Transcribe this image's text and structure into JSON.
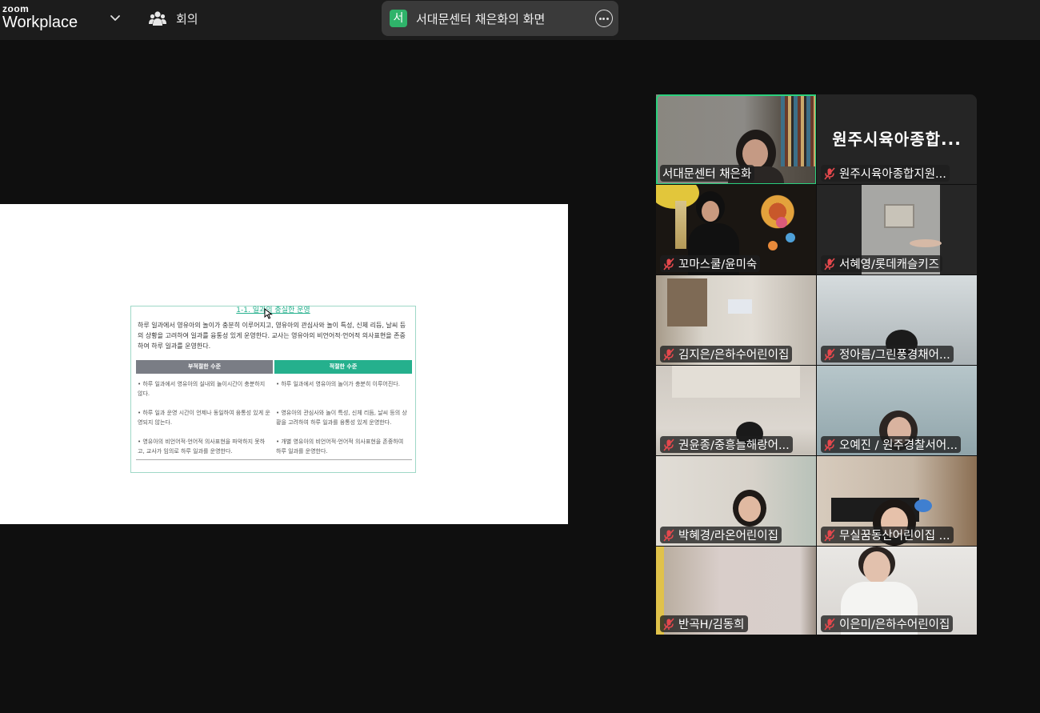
{
  "app": {
    "logo_small": "zoom",
    "logo_large": "Workplace"
  },
  "header": {
    "meeting_label": "회의",
    "share": {
      "badge": "서",
      "title": "서대문센터 채은화의 화면"
    }
  },
  "slide": {
    "title": "1-1. 일과의 충실한 운영",
    "paragraph": "하루 일과에서 영유아의 놀이가 충분히 이루어지고, 영유아의 관심사와 놀이 특성, 신체 리듬, 날씨 등의 상황을 고려하여 일과를 융통성 있게 운영한다. 교사는 영유아의 비언어적·언어적 의사표현을 존중하여 하루 일과를 운영한다.",
    "col_bad": "부적절한 수준",
    "col_good": "적절한 수준",
    "rows": [
      {
        "bad": "• 하루 일과에서 영유아의 실내외 놀이시간이 충분하지 않다.",
        "good": "• 하루 일과에서 영유아의 놀이가 충분히 이루어진다."
      },
      {
        "bad": "• 하루 일과 운영 시간이 언제나 동일하여 융통성 있게 운영되지 않는다.",
        "good": "• 영유아의 관심사와 놀이 특성, 신체 리듬, 날씨 등의 상황을 고려하여 하루 일과를 융통성 있게 운영한다."
      },
      {
        "bad": "• 영유아의 비언어적·언어적 의사표현을 파악하지 못하고, 교사가 임의로 하루 일과를 운영한다.",
        "good": "• 개별 영유아의 비언어적·언어적 의사표현을 존중하여 하루 일과를 운영한다."
      }
    ]
  },
  "participants": [
    {
      "name": "서대문센터 채은화",
      "muted": false,
      "active": true
    },
    {
      "name": "원주시육아종합지원...",
      "muted": true,
      "avatar_text": "원주시육아종합..."
    },
    {
      "name": "꼬마스쿨/윤미숙",
      "muted": true
    },
    {
      "name": "서혜영/롯데캐슬키즈",
      "muted": true
    },
    {
      "name": "김지은/은하수어린이집",
      "muted": true
    },
    {
      "name": "정아름/그린풍경채어...",
      "muted": true
    },
    {
      "name": "권윤종/중흥늘해랑어...",
      "muted": true
    },
    {
      "name": "오예진 / 원주경찰서어...",
      "muted": true
    },
    {
      "name": "박혜경/라온어린이집",
      "muted": true
    },
    {
      "name": "무실꿈동산어린이집 ...",
      "muted": true
    },
    {
      "name": "반곡H/김동희",
      "muted": true
    },
    {
      "name": "이은미/은하수어린이집",
      "muted": true
    }
  ],
  "colors": {
    "active_speaker": "#2bd07d",
    "muted_icon": "#e5484d",
    "accent": "#25b08d"
  }
}
